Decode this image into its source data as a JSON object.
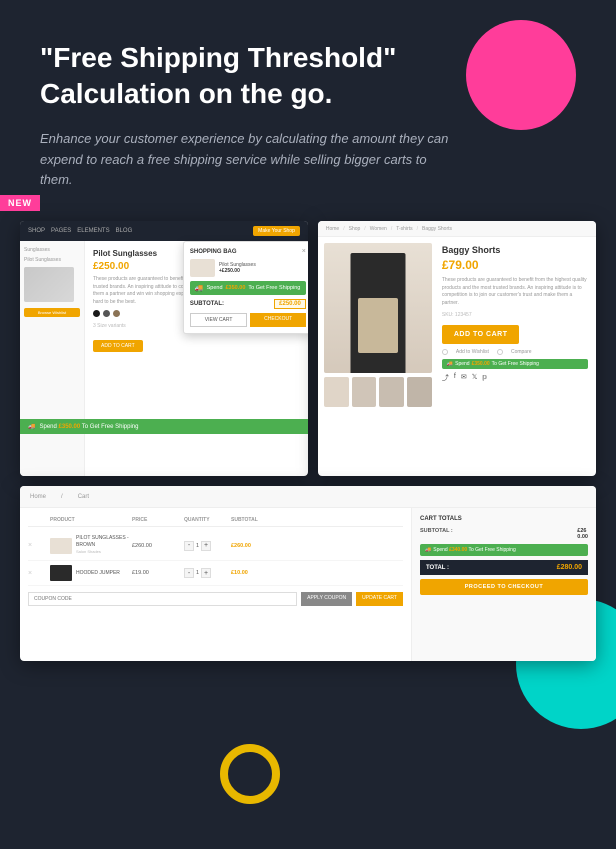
{
  "header": {
    "title": "\"Free Shipping Threshold\" Calculation on the go.",
    "subtitle": "Enhance your customer experience by calculating the amount they can expend to reach a free shipping service while selling bigger carts to them.",
    "badge": "NEW"
  },
  "left_screenshot": {
    "nav_items": [
      "SHOP",
      "PAGES",
      "ELEMENTS",
      "BLOG"
    ],
    "nav_cta": "Make Your Shop",
    "breadcrumb": "Sunglasses / Pilot Sunglasses",
    "product_name": "Pilot Sunglasses",
    "product_price": "£250.00",
    "product_desc": "These products are guaranteed to benefit from the highest quality products and the most trusted brands. An inspiring attitude to competition is to join our customer's trust and make them a partner and win win shopping experience. We always offer the best but we are trying hard to be the best.",
    "size_label": "3 Size variants",
    "add_to_cart": "ADD TO CART",
    "browse_wishlist": "Browse Wishlist"
  },
  "cart_popup": {
    "title": "SHOPPING BAG",
    "item_name": "Pilot Sunglasses",
    "item_price": "+£250.00",
    "close": "×",
    "shipping_text": "Spend ",
    "shipping_amount": "£350.00",
    "shipping_suffix": " To Get Free Shipping",
    "subtotal_label": "SUBTOTAL:",
    "subtotal_value": "£250.00",
    "view_cart": "VIEW CART",
    "checkout": "CHECKOUT"
  },
  "right_screenshot": {
    "breadcrumbs": [
      "Home",
      "Shop",
      "Women",
      "T-shirts",
      "Baggy Shorts"
    ],
    "product_name": "Baggy Shorts",
    "product_price": "£79.00",
    "product_desc": "These products are guaranteed to benefit from the highest quality products and the most trusted brands. An inspiring attitude is to competition is to join our customer's trust and make them a partner.",
    "sku": "SKU: 123457",
    "add_to_cart": "ADD TO CART",
    "add_to_wishlist": "Add to Wishlist",
    "compare": "Compare",
    "shipping_text": "Spend ",
    "shipping_amount": "£350.00",
    "shipping_suffix": " To Get Free Shipping"
  },
  "cart_screenshot": {
    "table_headers": [
      "",
      "PRODUCT",
      "PRICE",
      "QUANTITY",
      "SUBTOTAL"
    ],
    "cart_header_label": "CART TOTALS",
    "rows": [
      {
        "name": "PILOT SUNGLASSES - BROWN",
        "brand": "Salon Shades",
        "price": "£260.00",
        "qty": "1",
        "subtotal": "£260.00",
        "img_type": "light"
      },
      {
        "name": "HOODED JUMPER",
        "brand": "",
        "price": "£19.00",
        "qty": "1",
        "subtotal": "£10.00",
        "img_type": "dark"
      }
    ],
    "coupon_placeholder": "COUPON CODE",
    "apply_coupon": "APPLY COUPON",
    "update_cart": "UPDATE CART",
    "subtotal_label": "SUBTOTAL :",
    "subtotal_value": "£260.00",
    "shipping_text": "Spend ",
    "shipping_amount": "£340.00",
    "shipping_suffix": " To Get Free Shipping",
    "total_label": "TOTAL :",
    "total_value": "£280.00",
    "proceed_btn": "PROCEED TO CHECKOUT"
  },
  "decorative": {
    "circle_pink": "pink circle top right",
    "circle_teal": "teal circle bottom right",
    "circle_yellow_outline": "yellow outline circle bottom center"
  }
}
